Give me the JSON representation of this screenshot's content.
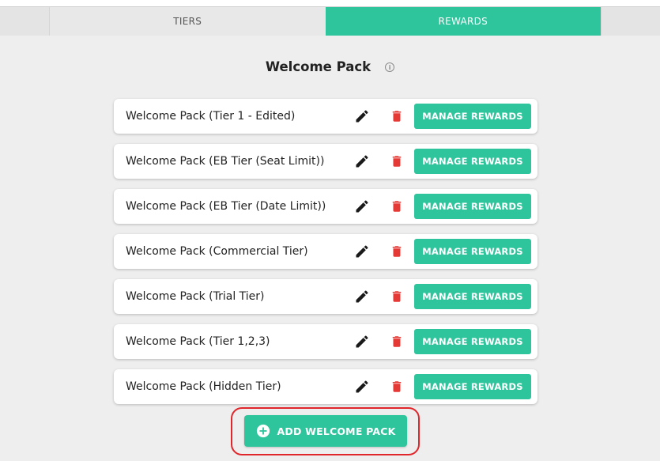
{
  "tabs": {
    "tiers_label": "TIERS",
    "rewards_label": "REWARDS"
  },
  "page": {
    "title": "Welcome Pack",
    "info_icon": "info-icon"
  },
  "welcome_packs": [
    {
      "label": "Welcome Pack (Tier 1 - Edited)",
      "action": "MANAGE REWARDS"
    },
    {
      "label": "Welcome Pack (EB Tier (Seat Limit))",
      "action": "MANAGE REWARDS"
    },
    {
      "label": "Welcome Pack (EB Tier (Date Limit))",
      "action": "MANAGE REWARDS"
    },
    {
      "label": "Welcome Pack (Commercial Tier)",
      "action": "MANAGE REWARDS"
    },
    {
      "label": "Welcome Pack (Trial Tier)",
      "action": "MANAGE REWARDS"
    },
    {
      "label": "Welcome Pack (Tier 1,2,3)",
      "action": "MANAGE REWARDS"
    },
    {
      "label": "Welcome Pack (Hidden Tier)",
      "action": "MANAGE REWARDS"
    }
  ],
  "add_button": {
    "label": "ADD WELCOME PACK",
    "icon": "plus-circle-icon"
  },
  "colors": {
    "accent": "#2ec49c",
    "delete": "#e53935",
    "highlight": "#e0262b",
    "background": "#eeeeee"
  }
}
